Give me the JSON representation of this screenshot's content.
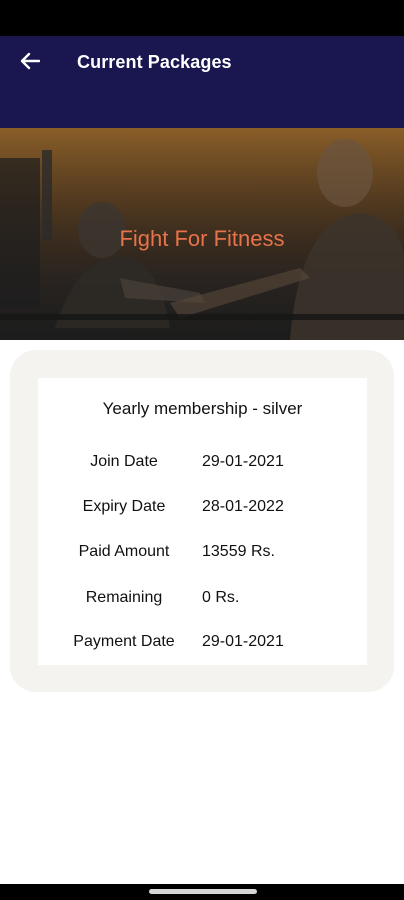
{
  "colors": {
    "app_bar": "#191650",
    "banner_title": "#e8734a",
    "card_background": "#f4f3f0"
  },
  "header": {
    "title": "Current Packages",
    "back_icon": "arrow-left-icon"
  },
  "banner": {
    "title": "Fight For Fitness"
  },
  "package": {
    "name": "Yearly membership - silver",
    "rows": [
      {
        "label": "Join Date",
        "value": "29-01-2021"
      },
      {
        "label": "Expiry Date",
        "value": "28-01-2022"
      },
      {
        "label": "Paid Amount",
        "value": "13559 Rs."
      },
      {
        "label": "Remaining",
        "value": "0 Rs."
      },
      {
        "label": "Payment Date",
        "value": "29-01-2021"
      }
    ]
  }
}
